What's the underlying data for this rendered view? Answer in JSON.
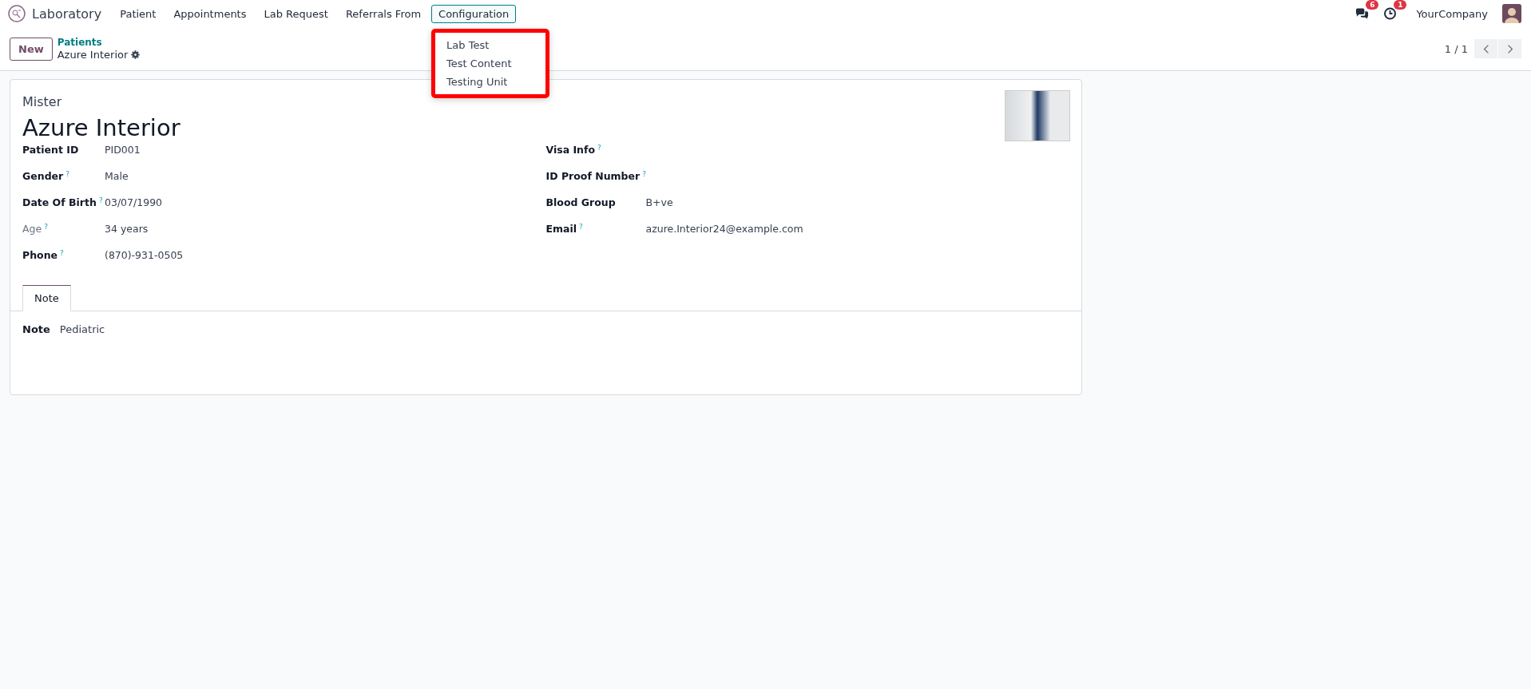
{
  "navbar": {
    "app_name": "Laboratory",
    "menu": [
      {
        "label": "Patient",
        "selected": false
      },
      {
        "label": "Appointments",
        "selected": false
      },
      {
        "label": "Lab Request",
        "selected": false
      },
      {
        "label": "Referrals From",
        "selected": false
      },
      {
        "label": "Configuration",
        "selected": true
      }
    ],
    "dropdown": {
      "highlighted": true,
      "items": [
        "Lab Test",
        "Test Content",
        "Testing Unit"
      ]
    },
    "messages_count": "6",
    "activities_count": "1",
    "company": "YourCompany"
  },
  "control_panel": {
    "new_button": "New",
    "breadcrumb": "Patients",
    "record_name": "Azure Interior",
    "pager": "1 / 1"
  },
  "form": {
    "title": "Mister",
    "name": "Azure Interior",
    "left_fields": [
      {
        "label": "Patient ID",
        "value": "PID001",
        "muted": false
      },
      {
        "label": "Gender",
        "help_mark": "?",
        "value": "Male",
        "muted": false
      },
      {
        "label": "Date Of Birth",
        "help_mark": "?",
        "value": "03/07/1990",
        "muted": false
      },
      {
        "label": "Age",
        "help_mark": "?",
        "value": "34 years",
        "muted": true
      },
      {
        "label": "Phone",
        "help_mark": "?",
        "value": "(870)-931-0505",
        "muted": false
      }
    ],
    "right_fields": [
      {
        "label": "Visa Info",
        "help_mark": "?",
        "muted": false
      },
      {
        "label": "ID Proof Number",
        "help_mark": "?",
        "muted": false
      },
      {
        "label": "Blood Group",
        "value": "B+ve",
        "muted": false
      },
      {
        "label": "Email",
        "help_mark": "?",
        "value": "azure.Interior24@example.com",
        "muted": false
      }
    ],
    "tabs": [
      {
        "label": "Note",
        "selected": true
      }
    ],
    "note": {
      "label": "Note",
      "value": "Pediatric"
    }
  }
}
